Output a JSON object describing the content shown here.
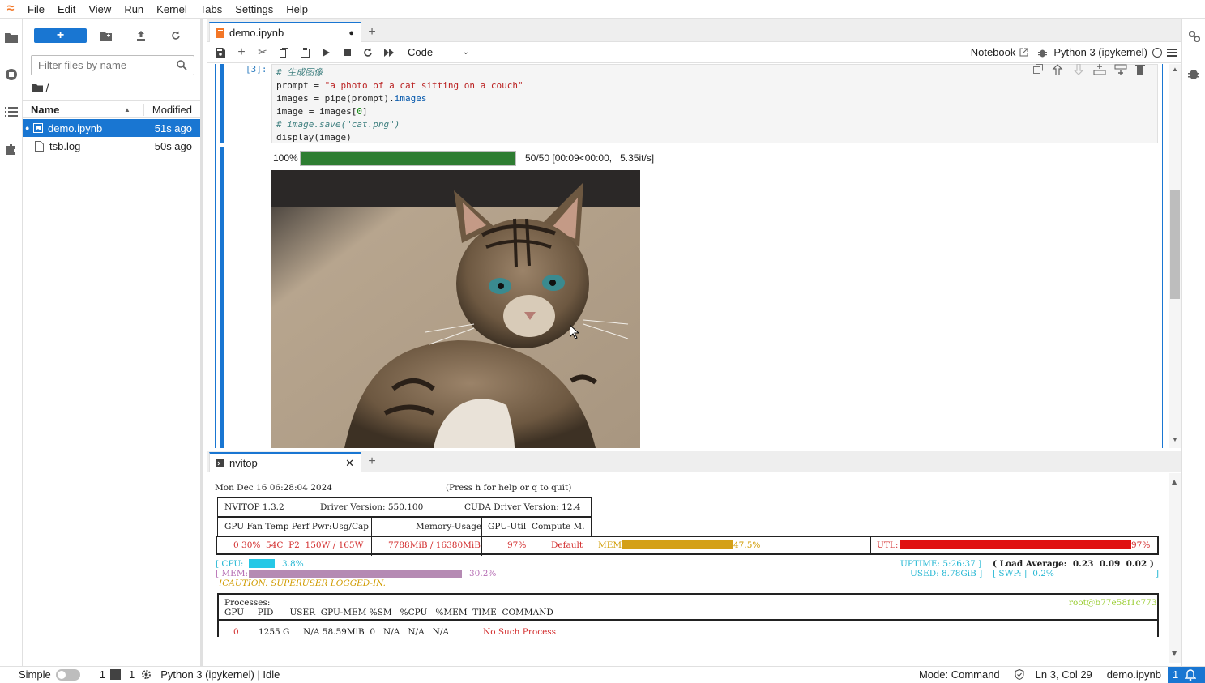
{
  "menubar": {
    "items": [
      "File",
      "Edit",
      "View",
      "Run",
      "Kernel",
      "Tabs",
      "Settings",
      "Help"
    ]
  },
  "filebrowser": {
    "new_label": "+",
    "filter_placeholder": "Filter files by name",
    "breadcrumb": "/",
    "col_name": "Name",
    "col_modified": "Modified",
    "files": [
      {
        "name": "demo.ipynb",
        "modified": "51s ago"
      },
      {
        "name": "tsb.log",
        "modified": "50s ago"
      }
    ]
  },
  "notebook": {
    "tab_title": "demo.ipynb",
    "cell_type": "Code",
    "notebook_label": "Notebook",
    "kernel_label": "Python 3 (ipykernel)",
    "cell_prompt": "[3]:",
    "code": {
      "line1": "# 生成图像",
      "line2a": "prompt = ",
      "line2b": "\"a photo of a cat sitting on a couch\"",
      "line3a": "images = pipe(prompt).",
      "line3b": "images",
      "line4a": "image = images[",
      "line4b": "0",
      "line4c": "]",
      "line5": "# image.save(\"cat.png\")",
      "line6": "display(image)"
    },
    "progress_pct_label": "100%",
    "progress_fraction": 1.0,
    "progress_stats": "50/50 [00:09<00:00,   5.35it/s]"
  },
  "terminal": {
    "tab_title": "nvitop",
    "datetime": "Mon Dec 16 06:28:04 2024",
    "help_hint": "(Press h for help or q to quit)",
    "nvitop_version": "NVITOP 1.3.2",
    "driver_version": "Driver Version: 550.100",
    "cuda_version": "CUDA Driver Version: 12.4",
    "hdr_gpu": "GPU Fan Temp Perf Pwr:Usg/Cap",
    "hdr_mem": "Memory-Usage",
    "hdr_util": "GPU-Util  Compute M.",
    "gpu_row": "0 30%  54C  P2  150W / 165W",
    "gpu_mem": "7788MiB / 16380MiB",
    "gpu_util": "97%",
    "gpu_compute": "Default",
    "mem_label": "MEM:",
    "mem_pct": "47.5%",
    "mem_fraction": 0.475,
    "utl_label": "UTL:",
    "utl_pct": "97%",
    "utl_fraction": 0.97,
    "cpu_label": "[ CPU:",
    "cpu_pct": "3.8%",
    "cpu_fraction": 0.038,
    "hostmem_label": "[ MEM:",
    "hostmem_pct": "30.2%",
    "hostmem_fraction": 0.302,
    "caution": "!CAUTION: SUPERUSER LOGGED-IN.",
    "uptime": "UPTIME: 5:26:37 ]",
    "load_avg": "( Load Average:  0.23  0.09  0.02 )",
    "used": "USED: 8.78GiB ]",
    "swp": "[ SWP: |  0.2%",
    "processes_label": "Processes:",
    "host": "root@b77e58f1c773",
    "proc_headers": "GPU     PID      USER  GPU-MEM %SM   %CPU   %MEM  TIME  COMMAND",
    "proc_row_gpu": "0",
    "proc_row": "1255 G     N/A 58.59MiB  0   N/A   N/A   N/A",
    "proc_cmd": "No Such Process"
  },
  "statusbar": {
    "mode_simple": "Simple",
    "count1": "1",
    "count2": "1",
    "kernel_status": "Python 3 (ipykernel) | Idle",
    "mode": "Mode: Command",
    "position": "Ln 3, Col 29",
    "file": "demo.ipynb",
    "notifications": "1"
  },
  "colors": {
    "accent": "#1976d2",
    "progress": "#2e7d32",
    "gpu_mem_bar": "#d4a017",
    "utl_bar": "#e01010",
    "cpu_bar": "#25c8e6",
    "hostmem_bar": "#b58ab3"
  }
}
